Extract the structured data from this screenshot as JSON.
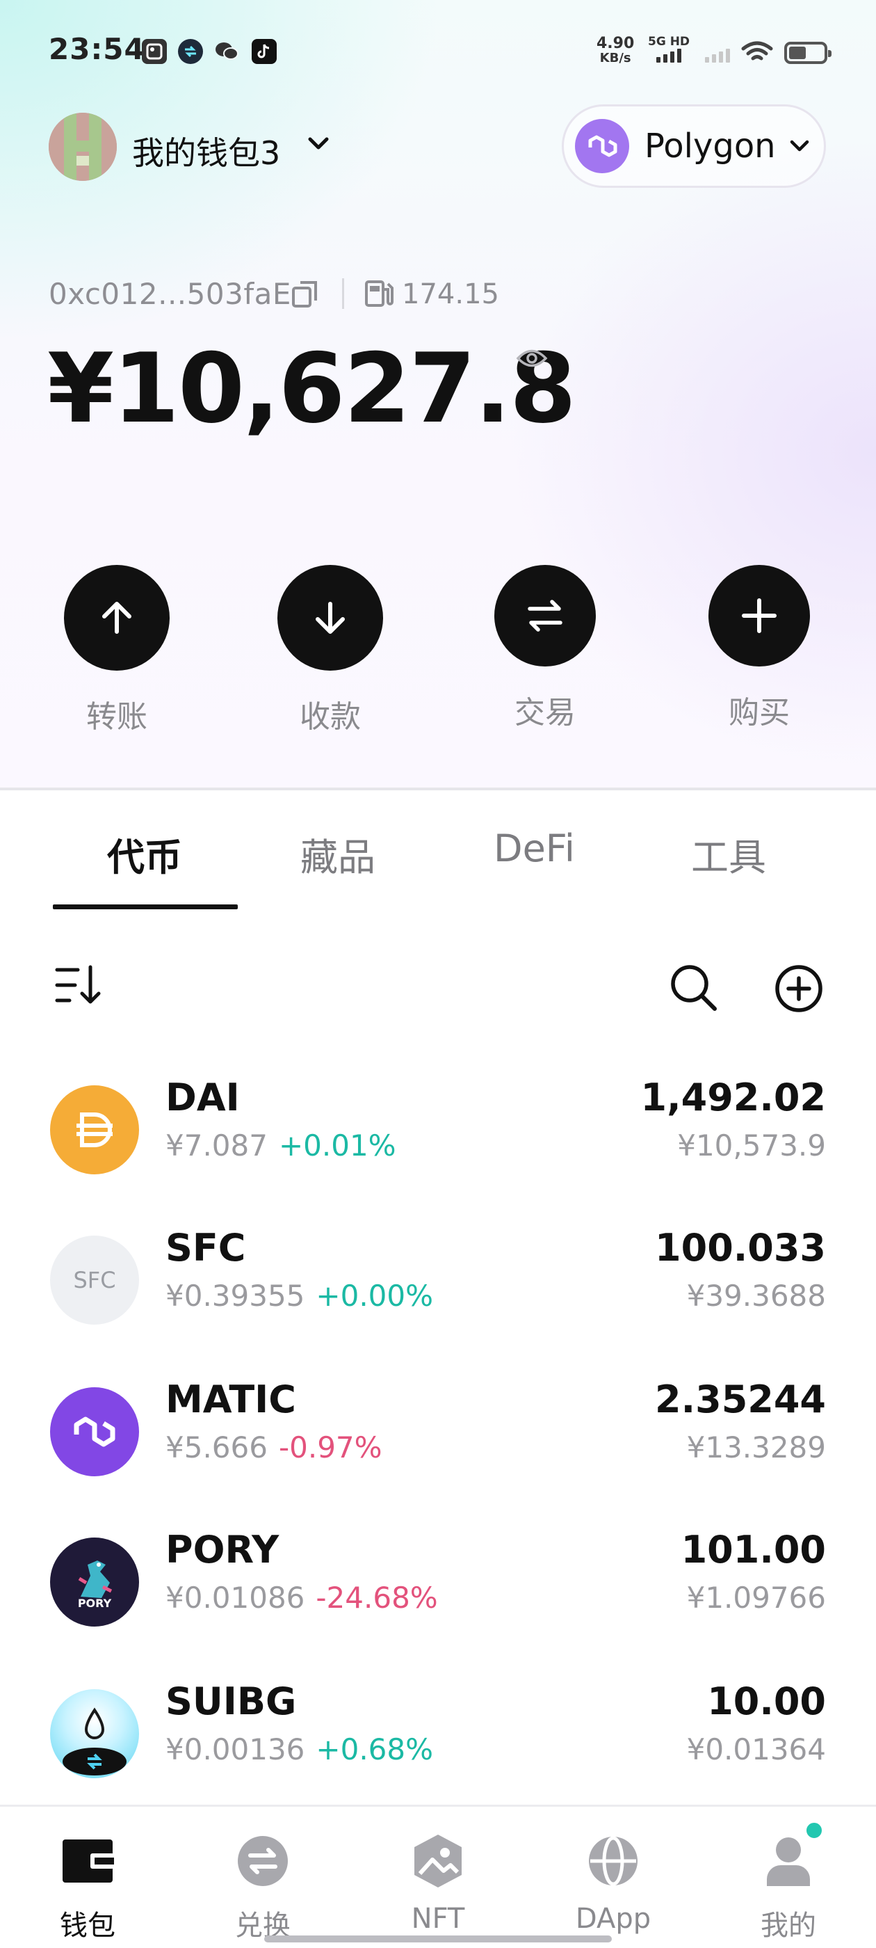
{
  "status_bar": {
    "time": "23:54",
    "net_speed_value": "4.90",
    "net_speed_unit": "KB/s",
    "network_label": "5G HD",
    "icons": [
      "gallery-app-icon",
      "sync-app-icon",
      "wechat-icon",
      "tiktok-icon",
      "signal-icon",
      "wifi-icon",
      "battery-icon"
    ]
  },
  "header": {
    "wallet_name": "我的钱包3",
    "chain_name": "Polygon"
  },
  "wallet": {
    "address": "0xc012...503faE",
    "gas": "174.15",
    "balance": "¥10,627.8"
  },
  "actions": [
    {
      "label": "转账",
      "icon": "arrow-up-icon"
    },
    {
      "label": "收款",
      "icon": "arrow-down-icon"
    },
    {
      "label": "交易",
      "icon": "swap-icon"
    },
    {
      "label": "购买",
      "icon": "plus-icon"
    }
  ],
  "tabs": [
    {
      "label": "代币",
      "active": true
    },
    {
      "label": "藏品",
      "active": false
    },
    {
      "label": "DeFi",
      "active": false
    },
    {
      "label": "工具",
      "active": false
    }
  ],
  "tokens": [
    {
      "symbol": "DAI",
      "price": "¥7.087",
      "change": "+0.01%",
      "direction": "up",
      "amount": "1,492.02",
      "value": "¥10,573.9",
      "logo_color": "#f5ac37"
    },
    {
      "symbol": "SFC",
      "price": "¥0.39355",
      "change": "+0.00%",
      "direction": "up",
      "amount": "100.033",
      "value": "¥39.3688",
      "logo_text": "SFC",
      "logo_color": "#eef0f3"
    },
    {
      "symbol": "MATIC",
      "price": "¥5.666",
      "change": "-0.97%",
      "direction": "down",
      "amount": "2.35244",
      "value": "¥13.3289",
      "logo_color": "#8247e5"
    },
    {
      "symbol": "PORY",
      "price": "¥0.01086",
      "change": "-24.68%",
      "direction": "down",
      "amount": "101.00",
      "value": "¥1.09766",
      "logo_text": "PORY",
      "logo_color": "#1f1a38"
    },
    {
      "symbol": "SUIBG",
      "price": "¥0.00136",
      "change": "+0.68%",
      "direction": "up",
      "amount": "10.00",
      "value": "¥0.01364",
      "logo_color": "#5ad5f2"
    }
  ],
  "bottom_nav": [
    {
      "label": "钱包",
      "icon": "wallet-icon",
      "active": true
    },
    {
      "label": "兑换",
      "icon": "exchange-icon",
      "active": false
    },
    {
      "label": "NFT",
      "icon": "nft-icon",
      "active": false
    },
    {
      "label": "DApp",
      "icon": "dapp-globe-icon",
      "active": false
    },
    {
      "label": "我的",
      "icon": "profile-icon",
      "active": false
    }
  ],
  "colors": {
    "positive": "#1bb9a4",
    "negative": "#e3527c",
    "polygon_purple": "#8247e5",
    "notification_dot": "#22c7b0"
  }
}
